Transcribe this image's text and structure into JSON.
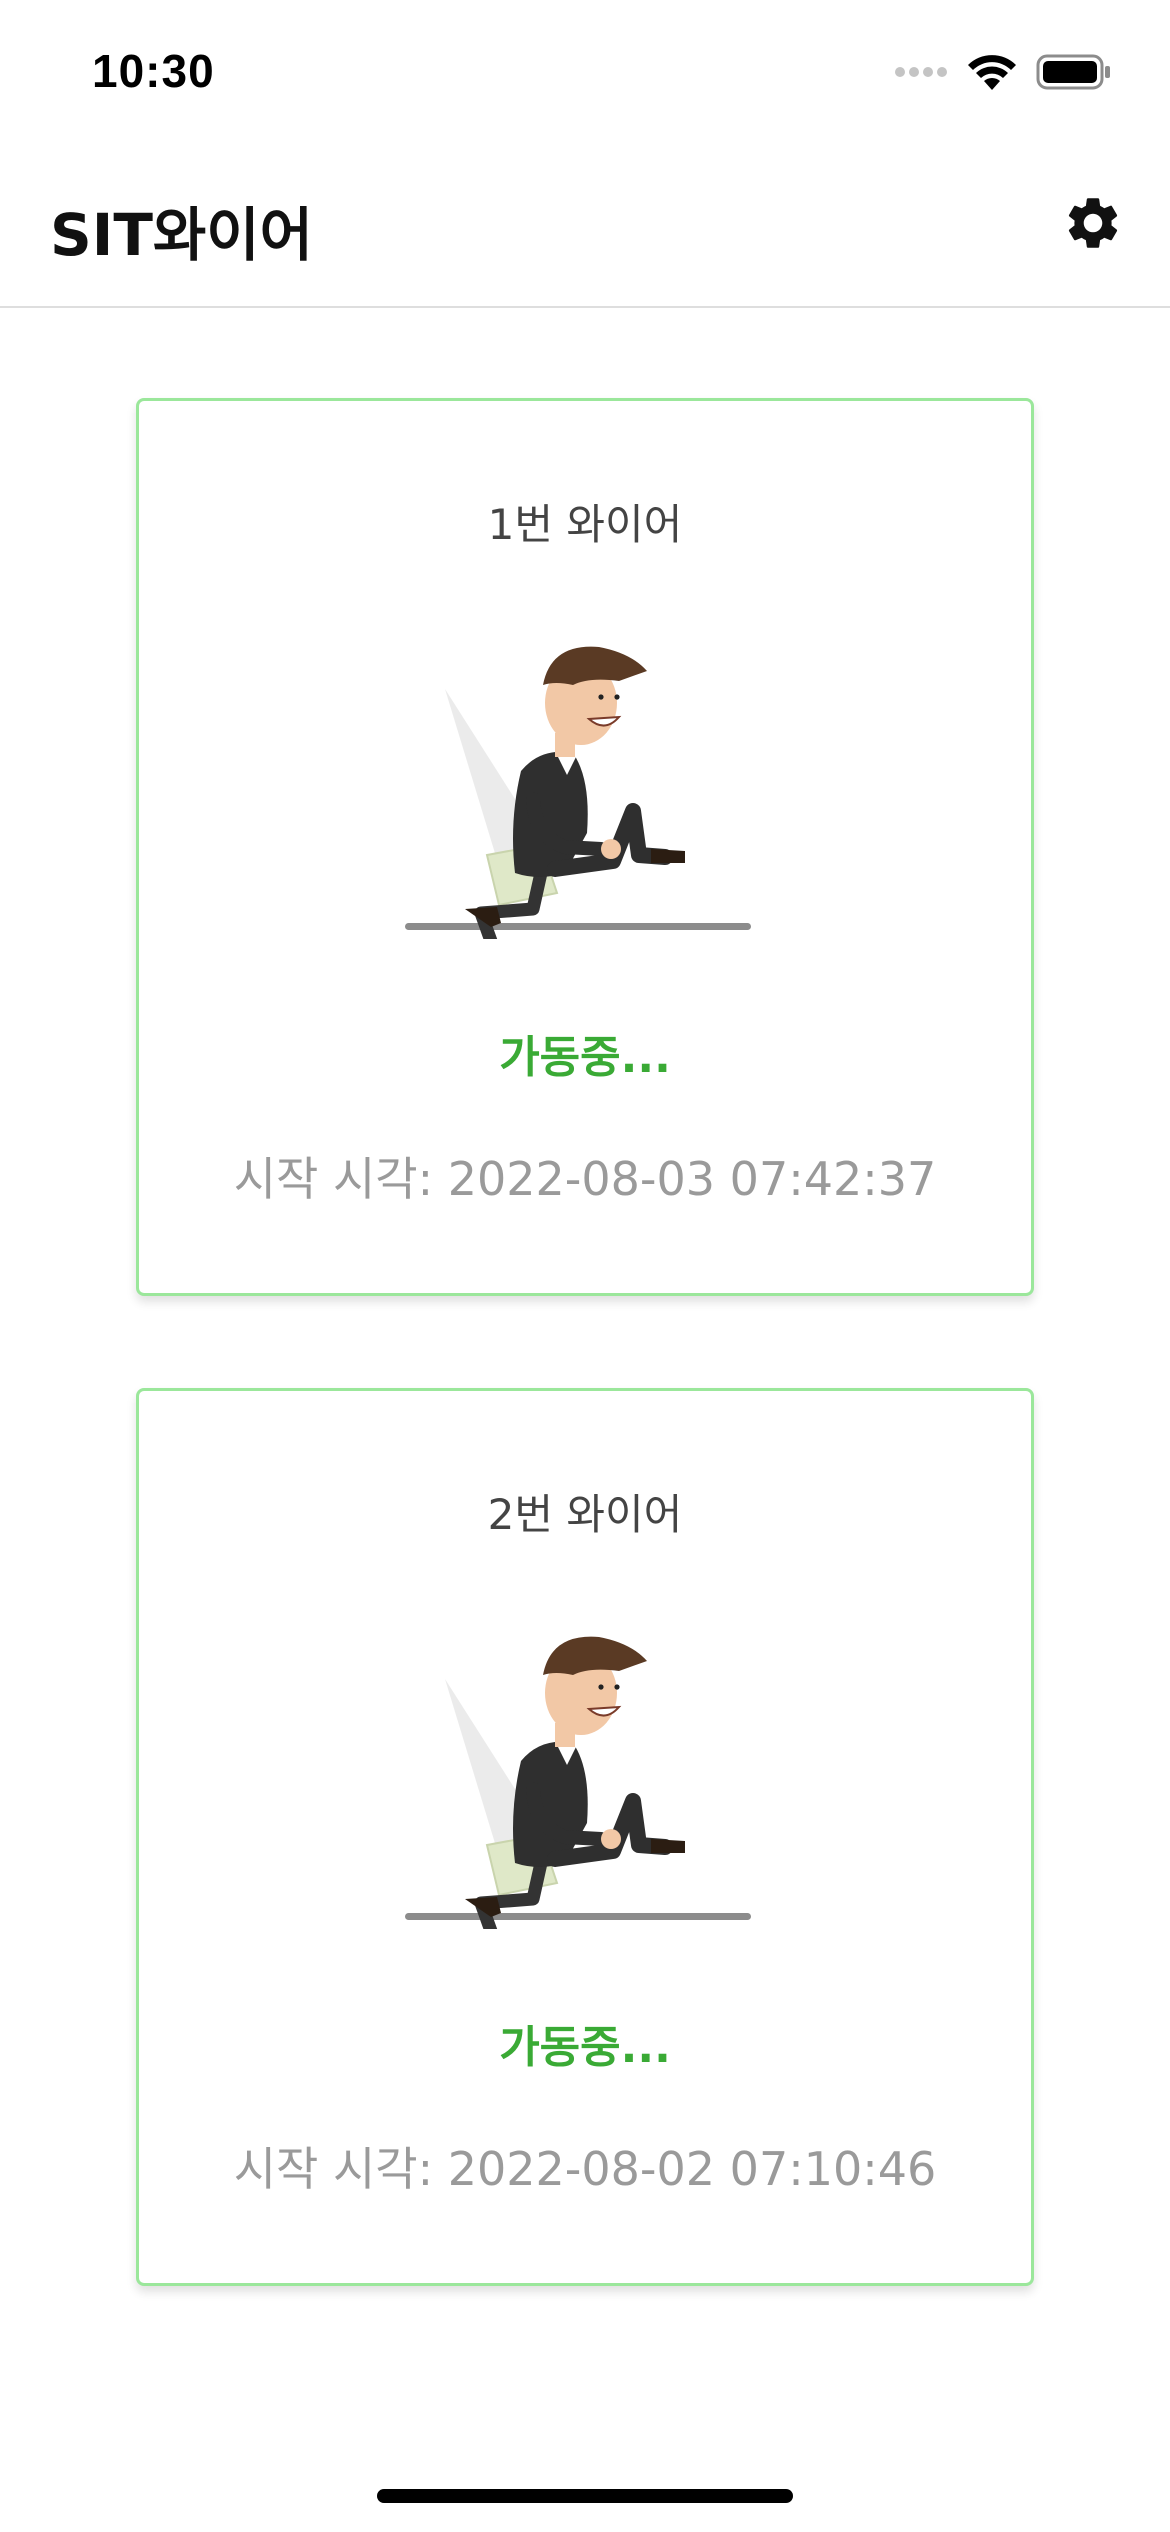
{
  "status_bar": {
    "time": "10:30",
    "icons": [
      "cellular-signal-icon",
      "wifi-icon",
      "battery-icon"
    ]
  },
  "header": {
    "title": "SIT와이어",
    "settings_icon": "gear-icon"
  },
  "colors": {
    "accent_green": "#3aaa35",
    "card_border": "#9be79b",
    "muted_text": "#9a9a9a"
  },
  "wires": [
    {
      "title": "1번 와이어",
      "illustration": "man-sitting-in-chair-illustration",
      "status": "가동중...",
      "start_time": "시작 시각: 2022-08-03 07:42:37"
    },
    {
      "title": "2번 와이어",
      "illustration": "man-sitting-in-chair-illustration",
      "status": "가동중...",
      "start_time": "시작 시각: 2022-08-02 07:10:46"
    }
  ]
}
